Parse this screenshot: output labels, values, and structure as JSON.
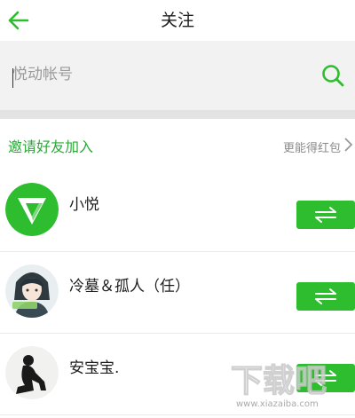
{
  "header": {
    "title": "关注",
    "back_icon": "arrow-left-icon"
  },
  "search": {
    "placeholder": "悦动帐号",
    "value": "",
    "icon": "search-icon"
  },
  "invite": {
    "label": "邀请好友加入",
    "hint": "更能得红包"
  },
  "users": [
    {
      "name": "小悦",
      "avatar": "yuedong-logo-avatar",
      "action_icon": "follow-exchange-icon"
    },
    {
      "name": "冷墓＆孤人（任）",
      "avatar": "anime-character-avatar",
      "action_icon": "follow-exchange-icon"
    },
    {
      "name": "安宝宝.",
      "avatar": "silhouette-avatar",
      "action_icon": "follow-exchange-icon"
    }
  ],
  "watermark": {
    "text": "下载吧",
    "subtext": "www.xiazaiba.com"
  },
  "colors": {
    "accent": "#2ebd2e",
    "invite_text": "#2aa938",
    "search_bg": "#f2f2f2",
    "divider": "#e3e3e3"
  }
}
